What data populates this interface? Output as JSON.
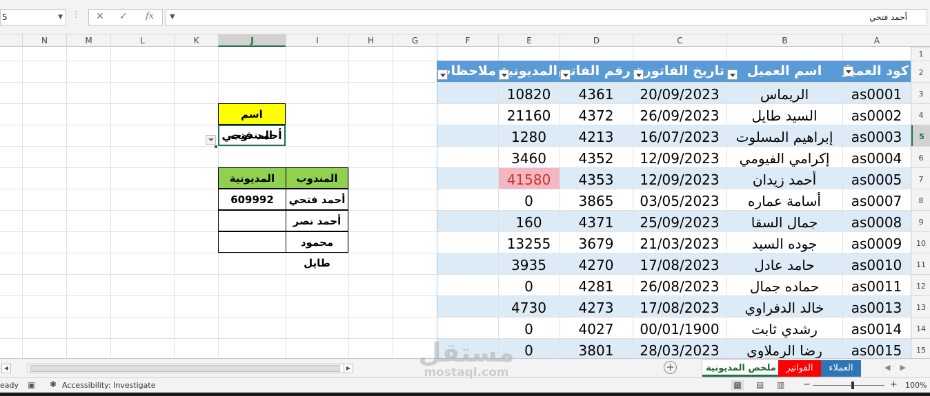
{
  "formula_bar": {
    "name_box": "5",
    "cancel_icon": "✕",
    "enter_icon": "✓",
    "fx_icon": "fx",
    "formula": "أحمد فتحي"
  },
  "columns": [
    "N",
    "M",
    "L",
    "K",
    "J",
    "I",
    "H",
    "G",
    "F",
    "E",
    "D",
    "C",
    "B",
    "A"
  ],
  "rows": [
    "1",
    "2",
    "3",
    "4",
    "5",
    "6",
    "7",
    "8",
    "9",
    "10",
    "11",
    "12",
    "13",
    "14",
    "15"
  ],
  "table": {
    "headers": [
      "كود العميل",
      "اسم العميل",
      "تاريخ الفاتورة",
      "رقم الفاتورة",
      "المديونية",
      "ملاحظات"
    ],
    "rows": [
      [
        "as0001",
        "الريماس",
        "20/09/2023",
        "4361",
        "10820",
        ""
      ],
      [
        "as0002",
        "السيد طايل",
        "26/09/2023",
        "4372",
        "21160",
        ""
      ],
      [
        "as0003",
        "إبراهيم المسلوت",
        "16/07/2023",
        "4213",
        "1280",
        ""
      ],
      [
        "as0004",
        "إكرامي الفيومي",
        "12/09/2023",
        "4352",
        "3460",
        ""
      ],
      [
        "as0005",
        "أحمد زيدان",
        "12/09/2023",
        "4353",
        "41580",
        ""
      ],
      [
        "as0007",
        "أسامة عماره",
        "03/05/2023",
        "3865",
        "0",
        ""
      ],
      [
        "as0008",
        "جمال السقا",
        "25/09/2023",
        "4371",
        "160",
        ""
      ],
      [
        "as0009",
        "جوده السيد",
        "21/03/2023",
        "3679",
        "13255",
        ""
      ],
      [
        "as0010",
        "حامد عادل",
        "17/08/2023",
        "4270",
        "3935",
        ""
      ],
      [
        "as0011",
        "حماده جمال",
        "26/08/2023",
        "4281",
        "0",
        ""
      ],
      [
        "as0013",
        "خالد الدفراوي",
        "17/08/2023",
        "4273",
        "4730",
        ""
      ],
      [
        "as0014",
        "رشدي ثابت",
        "00/01/1900",
        "4027",
        "0",
        ""
      ],
      [
        "as0015",
        "رضا الرملاوي",
        "28/03/2023",
        "3801",
        "0",
        ""
      ]
    ],
    "highlight_row": 4,
    "highlight_color": "#f4b6c2",
    "highlight_text_color": "#c0392b",
    "header_color": "#5b9bd5",
    "band_color": "#ddebf7"
  },
  "rep_selector": {
    "label": "اسم المندوب",
    "value": "أحمد فتحي",
    "label_color": "#ffff00"
  },
  "summary": {
    "headers": [
      "المندوب",
      "المديونية"
    ],
    "rows": [
      [
        "أحمد فتحي",
        "609992"
      ],
      [
        "أحمد نصر",
        ""
      ],
      [
        "محمود طايل",
        ""
      ]
    ],
    "header_color": "#92d050"
  },
  "sheet_tabs": [
    {
      "label": "ملخص المديونية",
      "active": true
    },
    {
      "label": "الفواتير",
      "color": "#ff0000"
    },
    {
      "label": "العملاء",
      "color": "#2e75b6"
    }
  ],
  "status": {
    "ready": "eady",
    "accessibility": "Accessibility: Investigate",
    "zoom": "100%"
  },
  "watermark": {
    "arabic": "مستقل",
    "latin": "mostaql.com"
  }
}
